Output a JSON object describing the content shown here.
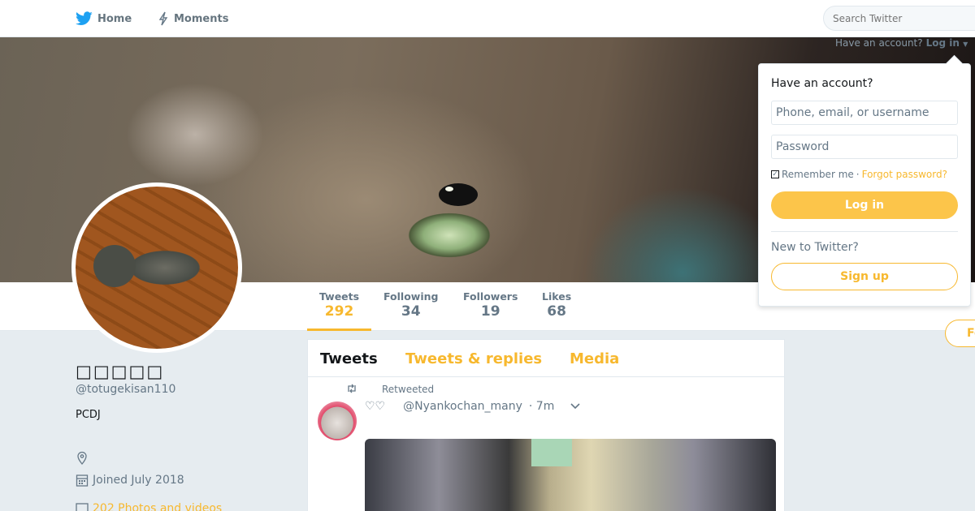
{
  "nav": {
    "home_label": "Home",
    "moments_label": "Moments",
    "search_placeholder": "Search Twitter"
  },
  "session": {
    "have_account_text": "Have an account?",
    "login_link": "Log in"
  },
  "profile": {
    "name": "□□□□□",
    "handle": "@totugekisan110",
    "bio": "PCDJ",
    "joined": "Joined July 2018",
    "photos": "202 Photos and videos",
    "follow_label": "Follow"
  },
  "stats": [
    {
      "label": "Tweets",
      "value": "292"
    },
    {
      "label": "Following",
      "value": "34"
    },
    {
      "label": "Followers",
      "value": "19"
    },
    {
      "label": "Likes",
      "value": "68"
    }
  ],
  "timeline": {
    "tabs": [
      "Tweets",
      "Tweets & replies",
      "Media"
    ],
    "tweet": {
      "retweeted_label": "Retweeted",
      "author_name": "♡♡",
      "author_handle": "@Nyankochan_many",
      "time": "· 7m"
    }
  },
  "login_popup": {
    "title": "Have an account?",
    "username_placeholder": "Phone, email, or username",
    "password_placeholder": "Password",
    "remember_label": "Remember me",
    "separator": "·",
    "forgot_label": "Forgot password?",
    "login_button": "Log in",
    "new_text": "New to Twitter?",
    "signup_button": "Sign up"
  },
  "colors": {
    "accent": "#f7b82e",
    "login_button_bg": "#fcc54a",
    "nav_bird": "#1da1f2"
  }
}
